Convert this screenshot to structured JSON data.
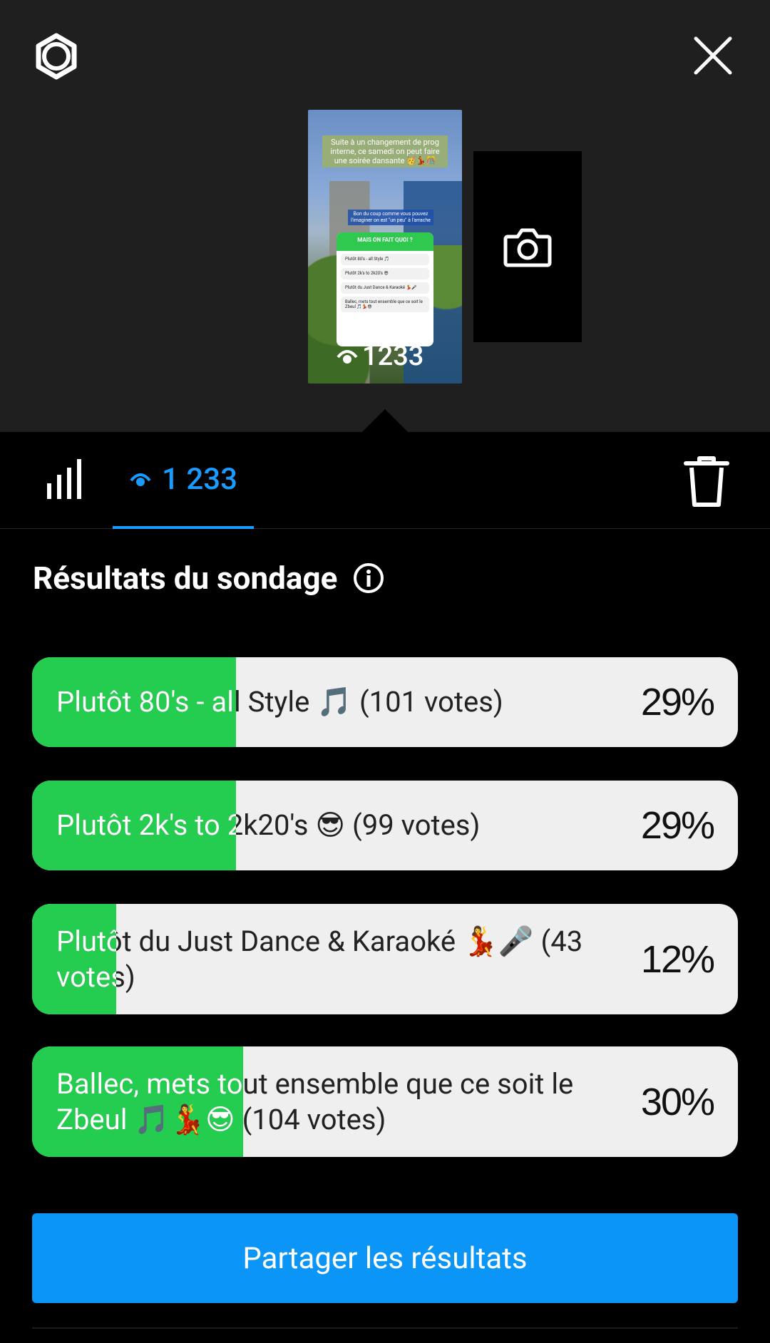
{
  "header": {
    "settings_icon": "settings-gear-icon",
    "close_icon": "close-icon"
  },
  "story_preview": {
    "caption": "Suite à un changement de prog interne, ce samedi on peut faire une soirée dansante 🥳💃🎊",
    "caption2": "Bon du coup comme vous pouvez l'imaginer on est \"un peu\" à l'arrache",
    "poll_question": "MAIS ON FAIT QUOI ?",
    "options": [
      "Plutôt 80's - all Style 🎵",
      "Plutôt 2k's to 2k20's 😎",
      "Plutôt du Just Dance & Karaoké 💃🎤",
      "Ballec, mets tout ensemble que ce soit le Zbeul 🎵💃😎"
    ],
    "views": "1233"
  },
  "camera": {
    "icon": "camera-icon"
  },
  "tabs": {
    "stats_icon": "bar-chart-icon",
    "views_label": "1 233",
    "trash_icon": "trash-icon"
  },
  "poll": {
    "title": "Résultats du sondage",
    "info_icon": "info-icon",
    "options": [
      {
        "label": "Plutôt 80's - all Style 🎵 (101 votes)",
        "percent": "29%",
        "fill": 0.29
      },
      {
        "label": "Plutôt 2k's to 2k20's 😎 (99 votes)",
        "percent": "29%",
        "fill": 0.29
      },
      {
        "label": "Plutôt du Just Dance & Karaoké 💃🎤 (43 votes)",
        "percent": "12%",
        "fill": 0.12
      },
      {
        "label": "Ballec, mets tout ensemble que ce soit le Zbeul 🎵💃😎 (104 votes)",
        "percent": "30%",
        "fill": 0.3
      }
    ],
    "share_label": "Partager les résultats"
  },
  "colors": {
    "accent_blue": "#1a9bff",
    "poll_green": "#24cd50",
    "poll_track": "#efefef",
    "share_button": "#0a95f7"
  }
}
